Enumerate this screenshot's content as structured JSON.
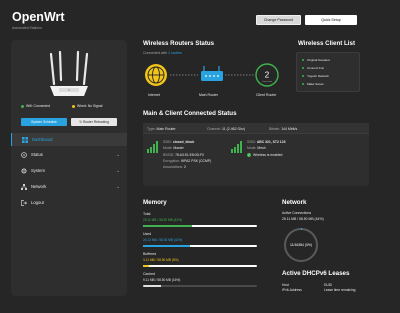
{
  "brand": {
    "title": "OpenWrt",
    "subtitle": "Associated Stations"
  },
  "header": {
    "change_password": "Change Password",
    "quick_setup": "Quick Setup"
  },
  "sidebar": {
    "wifi_status": "Wifi: Connected",
    "wired_status": "Wired: No Signal",
    "schedule_btn": "System Schedule",
    "reboot_btn": "Router Rebooting",
    "nav": [
      {
        "label": "Dashboard",
        "icon": "dashboard-icon",
        "active": true
      },
      {
        "label": "Status",
        "icon": "status-icon"
      },
      {
        "label": "System",
        "icon": "system-icon"
      },
      {
        "label": "Network",
        "icon": "network-icon"
      },
      {
        "label": "Logout",
        "icon": "logout-icon"
      }
    ]
  },
  "wireless_status": {
    "title": "Wireless Routers Status",
    "connected_prefix": "Connected with",
    "connected_count": "2 routers",
    "nodes": [
      "Internet",
      "Main Router",
      "Client Router"
    ],
    "client_count": "2",
    "client_count_caption": "Connection"
  },
  "client_list": {
    "title": "Wireless Client List",
    "items": [
      "Original Greatest",
      "Connect Fun",
      "Yogesh Network",
      "Make Sweet"
    ]
  },
  "connected_status": {
    "title": "Main & Client Connected Status",
    "type_label": "Type:",
    "type_value": "Main Router",
    "channel_label": "Channel:",
    "channel_value": "11 (2.462 Ghz)",
    "bitrate_label": "Bitrate:",
    "bitrate_value": "144 Mbit/s",
    "main": {
      "ssid_label": "SSID:",
      "ssid": "closed_block",
      "mode_label": "Mode:",
      "mode": "Master",
      "bssid_label": "BSSID:",
      "bssid": "78:A3:51:E8:0D:F0",
      "enc_label": "Encryption:",
      "enc": "WPA2 PSK (CCMP)",
      "assoc_label": "Associations:",
      "assoc": "2"
    },
    "client": {
      "ssid_label": "SSID:",
      "ssid": "ABC 321, ST2 123",
      "mode_label": "Mode:",
      "mode": "Mesh",
      "enabled_text": "Wireless is enabled"
    }
  },
  "memory": {
    "title": "Memory",
    "items": [
      {
        "label": "Total",
        "value": "25.11 MB / 58.30 MB (43%)",
        "percent": 43,
        "color": "#3fb34f"
      },
      {
        "label": "Used",
        "value": "24.13 MB / 58.30 MB (41%)",
        "percent": 41,
        "color": "#29a3e0"
      },
      {
        "label": "Buffered",
        "value": "3.11 MB / 58.50 MB (5%)",
        "percent": 5,
        "color": "#f0c419"
      },
      {
        "label": "Cached",
        "value": "9.11 MB / 58.50 MB (16%)",
        "percent": 16,
        "color": "#e0e0e0"
      }
    ]
  },
  "network": {
    "title": "Network",
    "active_label": "Active Connections",
    "active_value": "25.11 MB / 58.50 MB (44%)",
    "gauge_text": "11/16384 (0%)",
    "gauge_percent": 0
  },
  "dhcp": {
    "title": "Active DHCPv6 Leases",
    "col1a": "Host",
    "col2a": "DUID",
    "col1b": "IPv6-Address",
    "col2b": "Lease time remaining"
  }
}
